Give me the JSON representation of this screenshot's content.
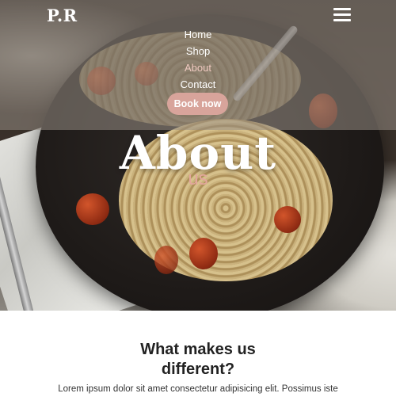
{
  "brand": {
    "logo_text": "P.R"
  },
  "nav": {
    "menu_icon": "hamburger-menu-icon",
    "items": [
      {
        "label": "Home",
        "active": false
      },
      {
        "label": "Shop",
        "active": false
      },
      {
        "label": "About",
        "active": true
      },
      {
        "label": "Contact",
        "active": false
      }
    ],
    "cta_label": "Book now"
  },
  "hero": {
    "title": "About",
    "subtitle": "us",
    "background_image": "pasta-plate-photo"
  },
  "section": {
    "title_line1": "What makes us",
    "title_line2": "different?",
    "body": "Lorem ipsum dolor sit amet consectetur adipisicing elit. Possimus iste"
  },
  "colors": {
    "accent": "#d8a49b",
    "active_link": "#efc9c0",
    "heading": "#222222"
  }
}
